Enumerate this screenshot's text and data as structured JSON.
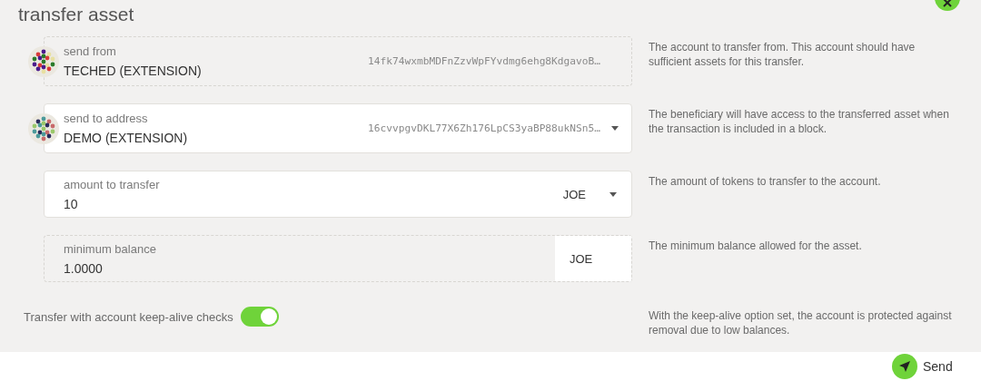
{
  "title": "transfer asset",
  "close_button": {
    "kind": "close"
  },
  "fields": [
    {
      "kind": "account",
      "label": "send from",
      "value": "TECHED (EXTENSION)",
      "address": "14fk74wxmbMDFnZzvWpFYvdmg6ehg8KdgavoB…",
      "disabled": true,
      "dropdown": false,
      "help": "The account to transfer from. This account should have sufficient assets for this transfer."
    },
    {
      "kind": "account",
      "label": "send to address",
      "value": "DEMO (EXTENSION)",
      "address": "16cvvpgvDKL77X6Zh176LpCS3yaBP88ukNSn5…",
      "disabled": false,
      "dropdown": true,
      "help": "The beneficiary will have access to the transferred asset when the transaction is included in a block."
    },
    {
      "kind": "amount",
      "label": "amount to transfer",
      "value": "10",
      "unit": "JOE",
      "disabled": false,
      "dropdown": true,
      "help": "The amount of tokens to transfer to the account."
    },
    {
      "kind": "amount",
      "label": "minimum balance",
      "value": "1.0000",
      "unit": "JOE",
      "disabled": true,
      "dropdown": false,
      "help": "The minimum balance allowed for the asset."
    }
  ],
  "keep_alive": {
    "label": "Transfer with account keep-alive checks",
    "on": true,
    "help": "With the keep-alive option set, the account is protected against removal due to low balances."
  },
  "send_button": {
    "label": "Send"
  }
}
